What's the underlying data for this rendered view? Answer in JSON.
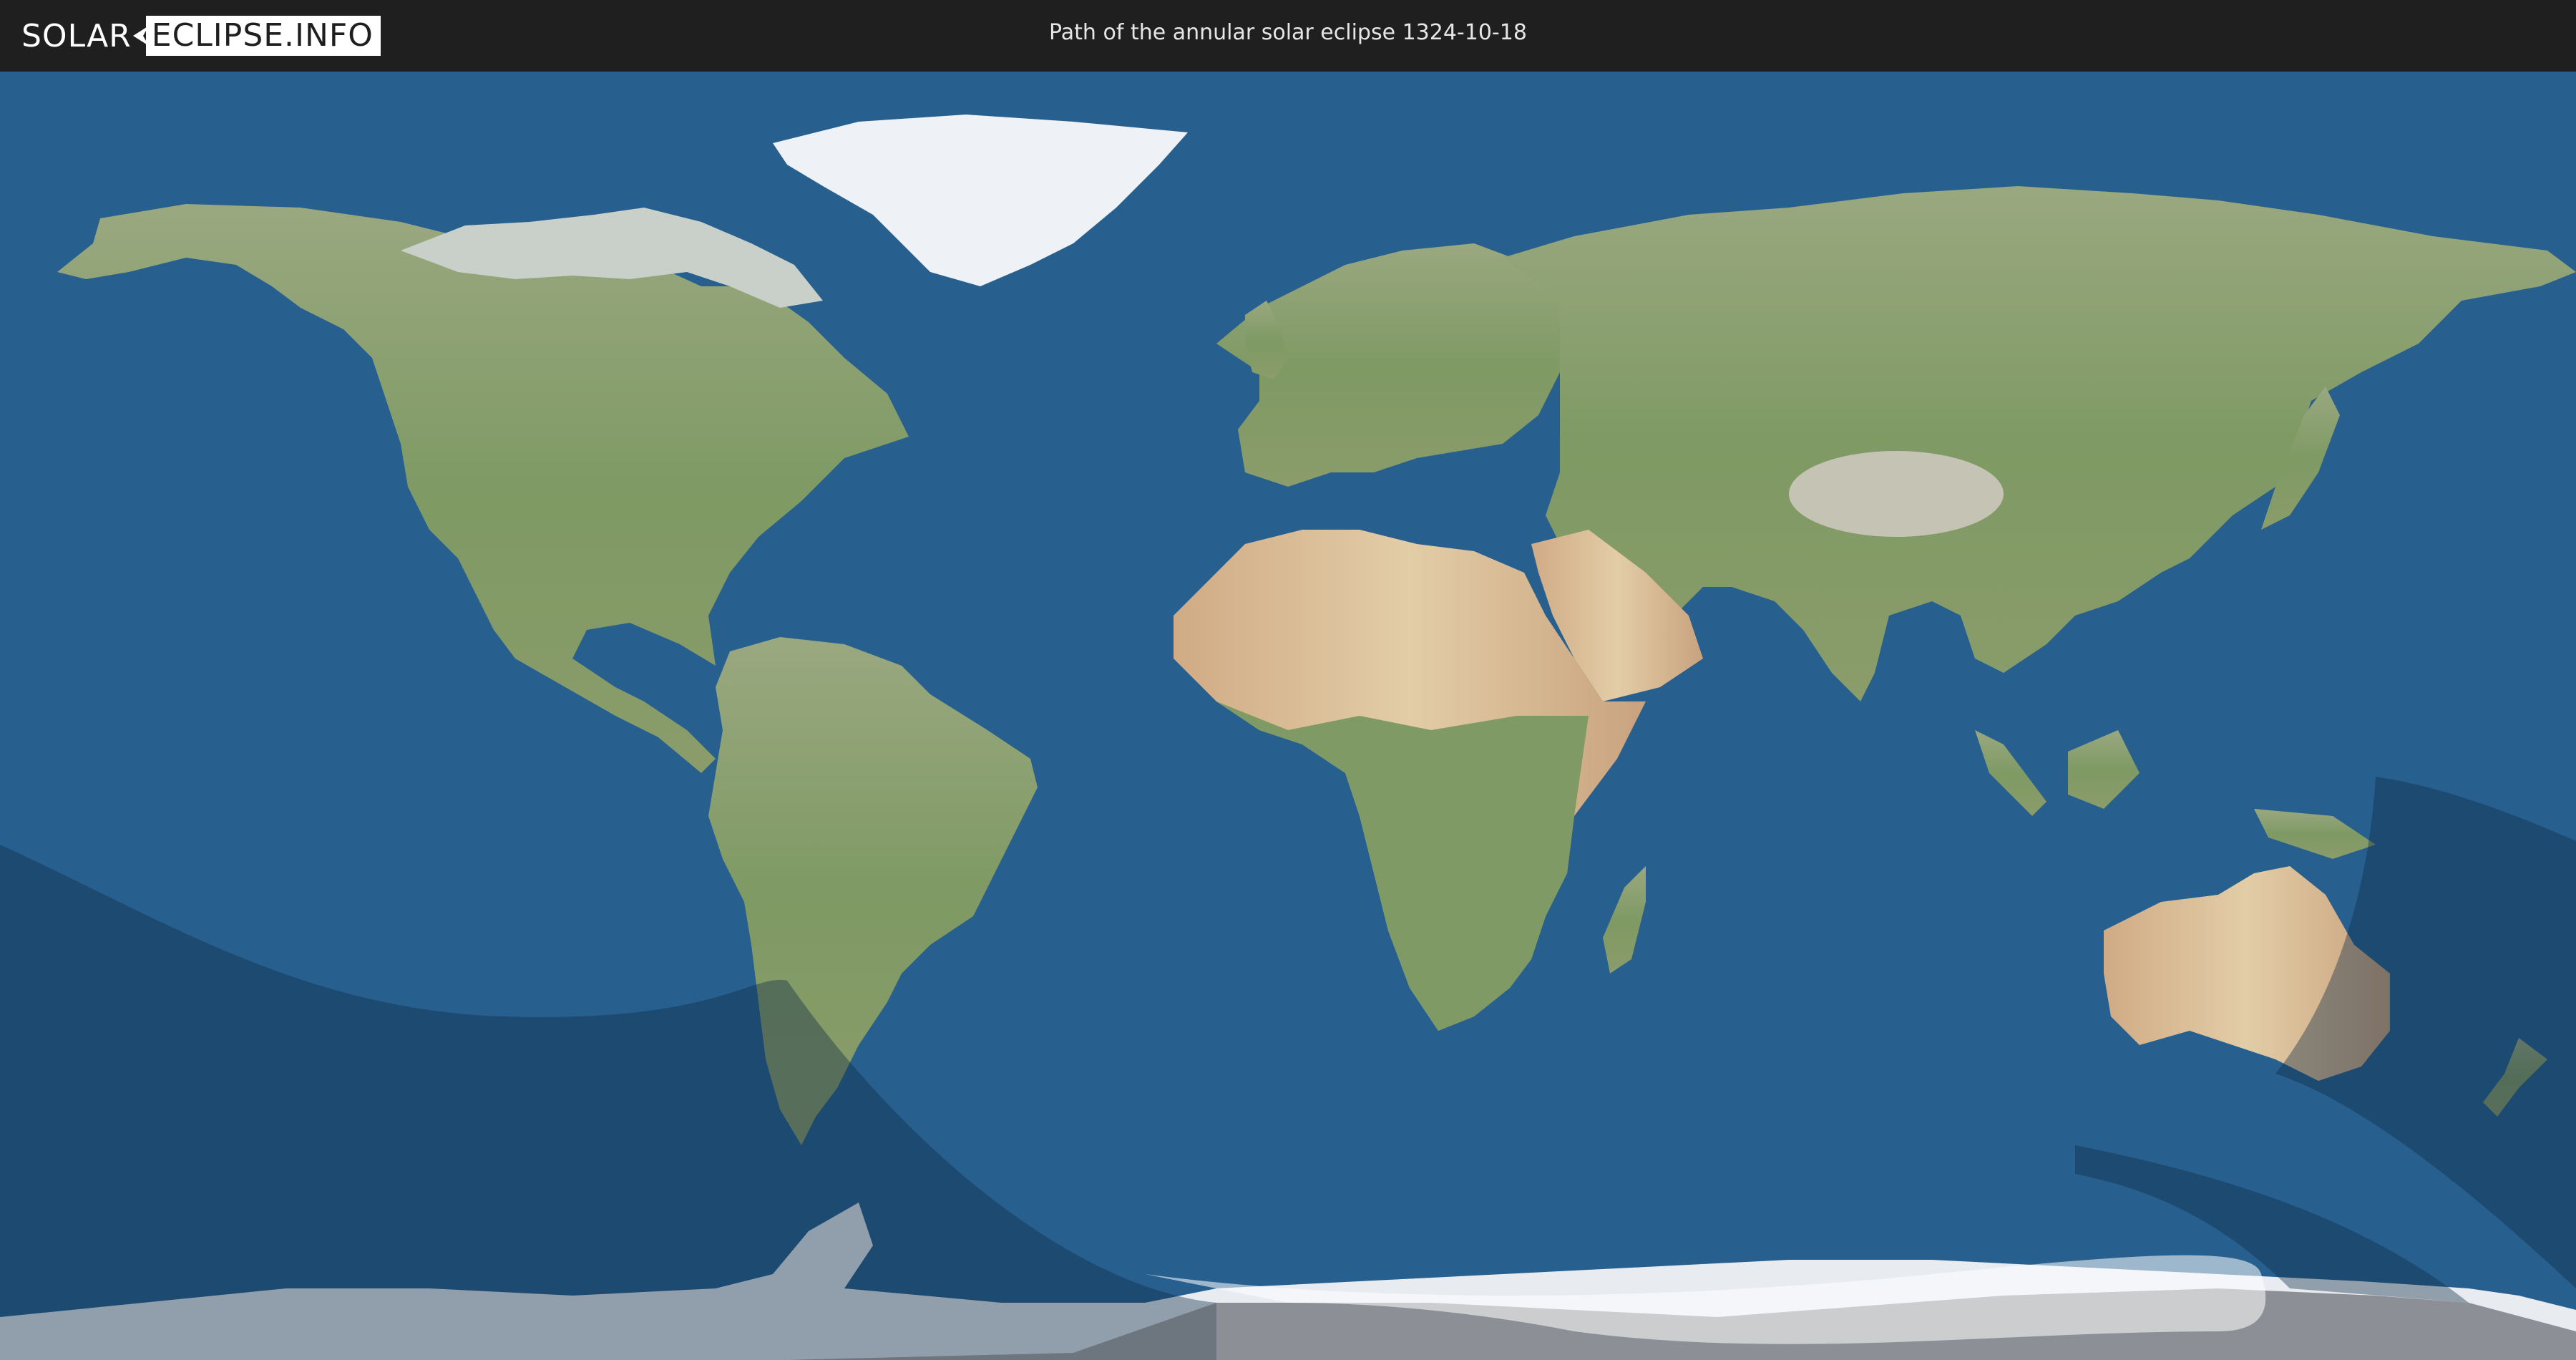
{
  "header": {
    "logo_part1": "SOLAR",
    "logo_part2": "ECLIPSE.INFO",
    "title": "Path of the annular solar eclipse 1324-10-18"
  },
  "map": {
    "projection": "equirectangular",
    "colors": {
      "ocean": "#27608e",
      "land": "#8a9c6a",
      "desert": "#c8a883",
      "ice": "#e8ecf1",
      "header": "#1f1f1f",
      "penumbra_shadow": "#1a3a5c",
      "night_shading": "#555a61"
    }
  }
}
